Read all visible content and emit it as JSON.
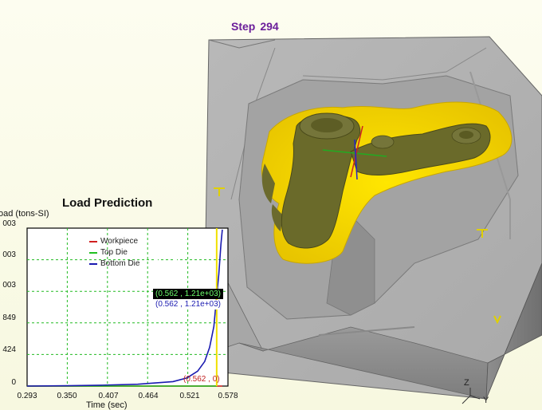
{
  "step": {
    "label": "Step",
    "value": "294"
  },
  "chart": {
    "title": "Load Prediction",
    "ylabel": "oad (tons-SI)",
    "xlabel": "Time (sec)",
    "yticks": [
      "003",
      "003",
      "003",
      "849",
      "424",
      "0"
    ],
    "xticks": [
      "0.293",
      "0.350",
      "0.407",
      "0.464",
      "0.521",
      "0.578"
    ],
    "legend": [
      {
        "label": "Workpiece",
        "color": "#d02020"
      },
      {
        "label": "Top Die",
        "color": "#20c020"
      },
      {
        "label": "Bottom Die",
        "color": "#1a1ab0"
      }
    ],
    "readouts": {
      "top_die": "(0.562 , 1.21e+03)",
      "bottom_die": "(0.562 , 1.21e+03)",
      "workpiece": "(0.562 , 0)"
    }
  },
  "chart_data": {
    "type": "line",
    "title": "Load Prediction",
    "xlabel": "Time (sec)",
    "ylabel": "oad (tons-SI)",
    "xlim": [
      0.293,
      0.578
    ],
    "ylim": [
      0,
      2120
    ],
    "grid": true,
    "legend_position": "top-right",
    "series": [
      {
        "name": "Workpiece",
        "color": "#d02020",
        "x": [
          0.293,
          0.4,
          0.5,
          0.562,
          0.57
        ],
        "y": [
          0,
          0,
          0,
          0,
          0
        ]
      },
      {
        "name": "Top Die",
        "color": "#20c020",
        "x": [
          0.293,
          0.562
        ],
        "y": [
          0,
          0
        ]
      },
      {
        "name": "Bottom Die",
        "color": "#1a1ab0",
        "x": [
          0.293,
          0.35,
          0.4,
          0.45,
          0.5,
          0.52,
          0.535,
          0.545,
          0.552,
          0.558,
          0.562,
          0.565,
          0.568,
          0.57
        ],
        "y": [
          0,
          5,
          12,
          25,
          60,
          110,
          200,
          330,
          520,
          800,
          1210,
          1500,
          1900,
          2100
        ]
      }
    ],
    "cursor_x": 0.562
  },
  "axes_triad": {
    "z": "Z",
    "y": "Y"
  }
}
